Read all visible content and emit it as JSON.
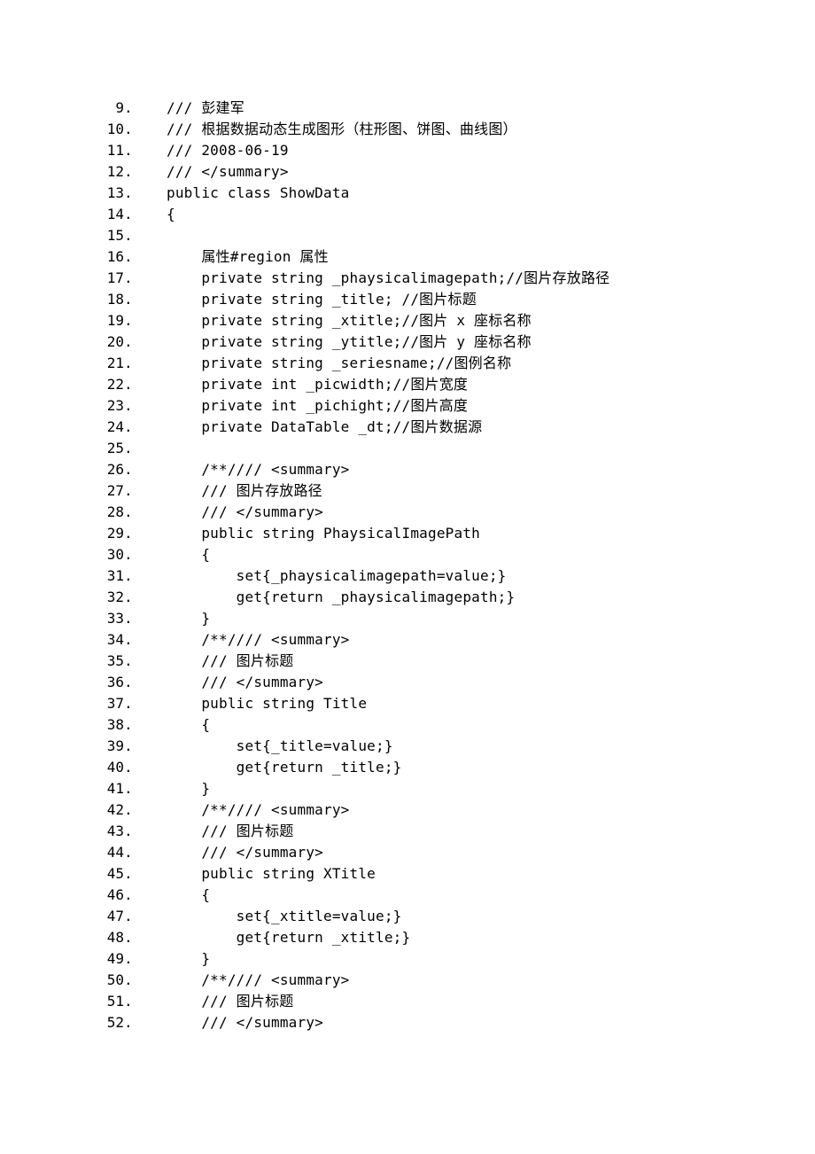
{
  "lines": [
    {
      "n": "9",
      "t": "/// 彭建军   "
    },
    {
      "n": "10",
      "t": "/// 根据数据动态生成图形（柱形图、饼图、曲线图）   "
    },
    {
      "n": "11",
      "t": "/// 2008-06-19   "
    },
    {
      "n": "12",
      "t": "/// </summary>   "
    },
    {
      "n": "13",
      "t": "public class ShowData   "
    },
    {
      "n": "14",
      "t": "{   "
    },
    {
      "n": "15",
      "t": "  "
    },
    {
      "n": "16",
      "t": "    属性#region 属性   "
    },
    {
      "n": "17",
      "t": "    private string _phaysicalimagepath;//图片存放路径   "
    },
    {
      "n": "18",
      "t": "    private string _title; //图片标题   "
    },
    {
      "n": "19",
      "t": "    private string _xtitle;//图片 x 座标名称   "
    },
    {
      "n": "20",
      "t": "    private string _ytitle;//图片 y 座标名称   "
    },
    {
      "n": "21",
      "t": "    private string _seriesname;//图例名称   "
    },
    {
      "n": "22",
      "t": "    private int _picwidth;//图片宽度   "
    },
    {
      "n": "23",
      "t": "    private int _pichight;//图片高度   "
    },
    {
      "n": "24",
      "t": "    private DataTable _dt;//图片数据源   "
    },
    {
      "n": "25",
      "t": "  "
    },
    {
      "n": "26",
      "t": "    /**//// <summary>   "
    },
    {
      "n": "27",
      "t": "    /// 图片存放路径   "
    },
    {
      "n": "28",
      "t": "    /// </summary>   "
    },
    {
      "n": "29",
      "t": "    public string PhaysicalImagePath   "
    },
    {
      "n": "30",
      "t": "    {   "
    },
    {
      "n": "31",
      "t": "        set{_phaysicalimagepath=value;}   "
    },
    {
      "n": "32",
      "t": "        get{return _phaysicalimagepath;}   "
    },
    {
      "n": "33",
      "t": "    }   "
    },
    {
      "n": "34",
      "t": "    /**//// <summary>   "
    },
    {
      "n": "35",
      "t": "    /// 图片标题   "
    },
    {
      "n": "36",
      "t": "    /// </summary>   "
    },
    {
      "n": "37",
      "t": "    public string Title   "
    },
    {
      "n": "38",
      "t": "    {   "
    },
    {
      "n": "39",
      "t": "        set{_title=value;}   "
    },
    {
      "n": "40",
      "t": "        get{return _title;}   "
    },
    {
      "n": "41",
      "t": "    }   "
    },
    {
      "n": "42",
      "t": "    /**//// <summary>   "
    },
    {
      "n": "43",
      "t": "    /// 图片标题   "
    },
    {
      "n": "44",
      "t": "    /// </summary>   "
    },
    {
      "n": "45",
      "t": "    public string XTitle   "
    },
    {
      "n": "46",
      "t": "    {   "
    },
    {
      "n": "47",
      "t": "        set{_xtitle=value;}   "
    },
    {
      "n": "48",
      "t": "        get{return _xtitle;}   "
    },
    {
      "n": "49",
      "t": "    }   "
    },
    {
      "n": "50",
      "t": "    /**//// <summary>   "
    },
    {
      "n": "51",
      "t": "    /// 图片标题   "
    },
    {
      "n": "52",
      "t": "    /// </summary>   "
    }
  ]
}
